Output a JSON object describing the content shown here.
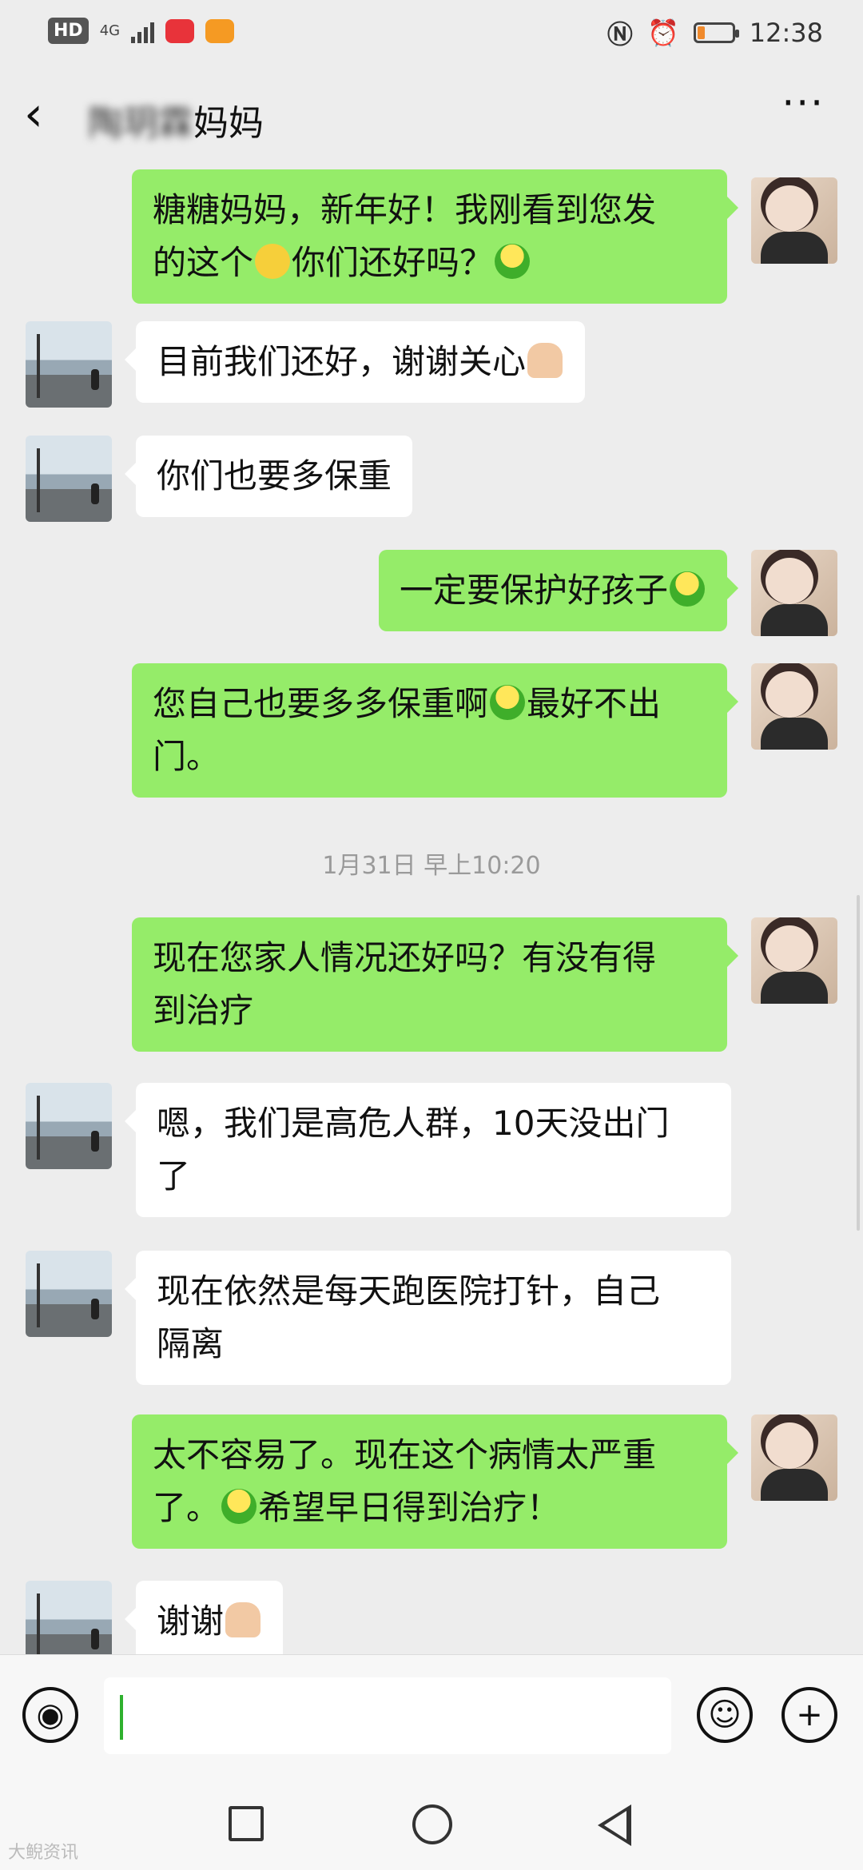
{
  "status_bar": {
    "hd": "HD",
    "network": "4G",
    "time": "12:38",
    "battery_level": 0.2
  },
  "header": {
    "contact_name_blurred": "陶玥霖",
    "contact_name_suffix": "妈妈",
    "back_icon": "chevron-left-icon",
    "more_icon": "more-dots-icon",
    "more_label": "···"
  },
  "messages": [
    {
      "from": "me",
      "text_a": "糖糖妈妈，新年好！我刚看到您发",
      "text_b": "的这个",
      "text_c": "你们还好吗？"
    },
    {
      "from": "friend",
      "text": "目前我们还好，谢谢关心"
    },
    {
      "from": "friend",
      "text": "你们也要多保重"
    },
    {
      "from": "me",
      "text": "一定要保护好孩子"
    },
    {
      "from": "me",
      "text_a": "您自己也要多多保重啊",
      "text_b": "最好不出",
      "text_c": "门。"
    },
    {
      "from": "friend",
      "text_a": "嗯，我们是高危人群，10天没出门",
      "text_b": "了"
    },
    {
      "from": "me",
      "text_a": "现在您家人情况还好吗？有没有得",
      "text_b": "到治疗"
    },
    {
      "from": "friend",
      "text_a": "现在依然是每天跑医院打针，自己",
      "text_b": "隔离"
    },
    {
      "from": "me",
      "text_a": "太不容易了。现在这个病情太严重",
      "text_b": "了。",
      "text_c": "希望早日得到治疗！"
    },
    {
      "from": "friend",
      "text": "谢谢"
    }
  ],
  "timestamp": "1月31日 早上10:20",
  "input_bar": {
    "voice_icon": "voice-icon",
    "emoji_icon": "emoji-icon",
    "plus_icon": "plus-icon",
    "voice_glyph": "◉",
    "emoji_glyph": "☺",
    "plus_glyph": "+",
    "value": ""
  },
  "nav_bar": {
    "recent_icon": "square-icon",
    "home_icon": "circle-icon",
    "back_icon": "triangle-back-icon"
  },
  "watermark": "大鲵资讯"
}
